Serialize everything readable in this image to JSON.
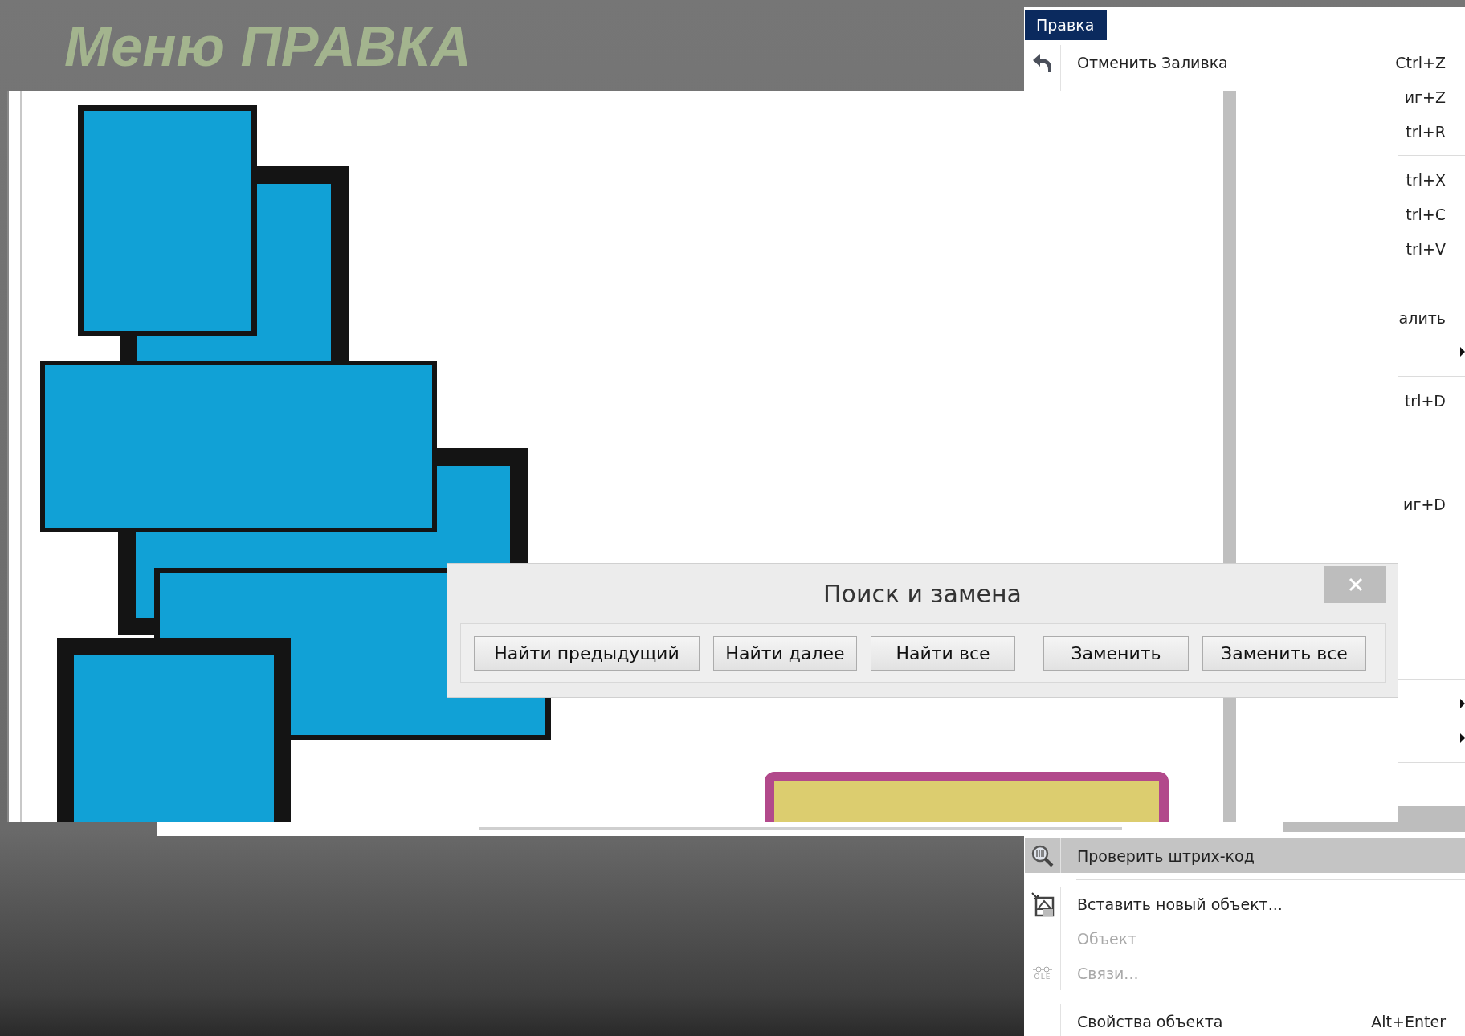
{
  "slide": {
    "title": "Меню ПРАВКА"
  },
  "menu": {
    "title": "Правка",
    "items": [
      {
        "kind": "item",
        "label": "Отменить Заливка",
        "shortcut": "Ctrl+Z"
      },
      {
        "kind": "item",
        "shortcut": "иг+Z"
      },
      {
        "kind": "item",
        "shortcut": "trl+R"
      },
      {
        "kind": "separator"
      },
      {
        "kind": "item",
        "shortcut": "trl+X"
      },
      {
        "kind": "item",
        "shortcut": "trl+C"
      },
      {
        "kind": "item",
        "shortcut": "trl+V"
      },
      {
        "kind": "covered"
      },
      {
        "kind": "item",
        "shortcut": "алить"
      },
      {
        "kind": "item",
        "submenu": true
      },
      {
        "kind": "separator"
      },
      {
        "kind": "item",
        "shortcut": "trl+D"
      },
      {
        "kind": "covered"
      },
      {
        "kind": "covered"
      },
      {
        "kind": "item",
        "shortcut": "иг+D"
      },
      {
        "kind": "separator"
      },
      {
        "kind": "covered"
      },
      {
        "kind": "covered"
      },
      {
        "kind": "covered"
      },
      {
        "kind": "covered"
      },
      {
        "kind": "separator"
      },
      {
        "kind": "item",
        "submenu": true
      },
      {
        "kind": "item",
        "submenu": true
      },
      {
        "kind": "separator"
      },
      {
        "kind": "covered"
      },
      {
        "kind": "covered"
      },
      {
        "kind": "item",
        "label": "Проверить штрих-код",
        "selected": true
      },
      {
        "kind": "separator"
      },
      {
        "kind": "item",
        "label": "Вставить новый объект...",
        "selected": false
      },
      {
        "kind": "item",
        "label": "Объект",
        "disabled": true,
        "selected": false
      },
      {
        "kind": "item",
        "label": "Связи...",
        "disabled": true,
        "icon_text": "OLE",
        "selected": false
      },
      {
        "kind": "separator"
      },
      {
        "kind": "item",
        "label": "Свойства объекта",
        "shortcut": "Alt+Enter",
        "selected": false
      }
    ]
  },
  "dialog": {
    "title": "Поиск и замена",
    "buttons": [
      "Найти предыдущий",
      "Найти далее",
      "Найти все",
      "Заменить",
      "Заменить все"
    ]
  }
}
